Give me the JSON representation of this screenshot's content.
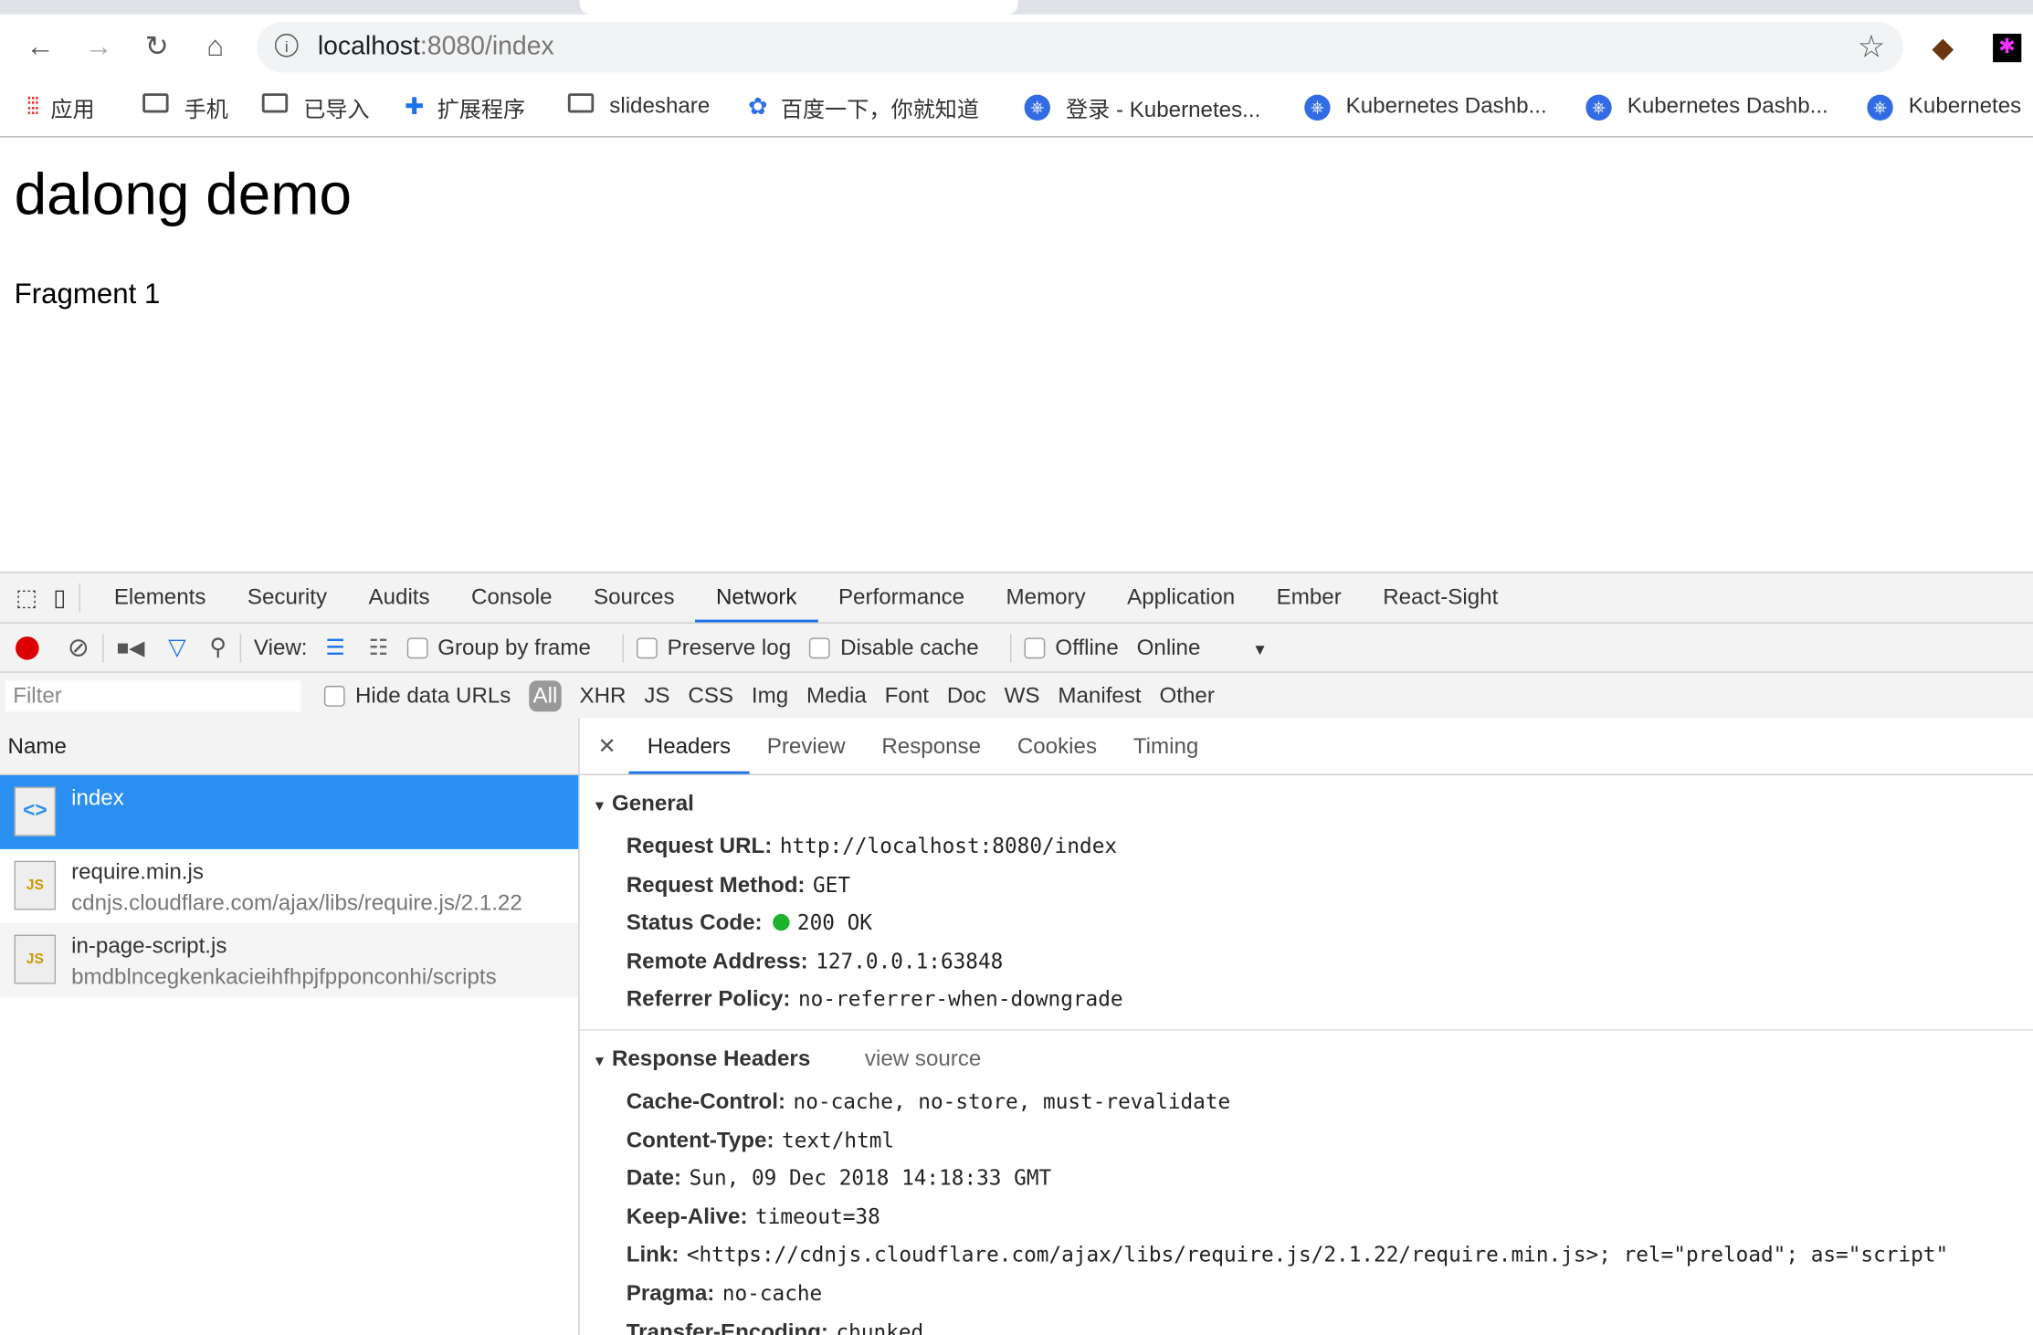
{
  "browser": {
    "url_host": "localhost",
    "url_rest": ":8080/index",
    "bookmarks": [
      {
        "label": "应用",
        "icon": "apps-grid-icon"
      },
      {
        "label": "手机",
        "icon": "folder-icon"
      },
      {
        "label": "已导入",
        "icon": "folder-icon"
      },
      {
        "label": "扩展程序",
        "icon": "puzzle-icon"
      },
      {
        "label": "slideshare",
        "icon": "folder-icon"
      },
      {
        "label": "百度一下，你就知道",
        "icon": "baidu-paw-icon"
      },
      {
        "label": "登录 - Kubernetes...",
        "icon": "kubernetes-icon"
      },
      {
        "label": "Kubernetes Dashb...",
        "icon": "kubernetes-icon"
      },
      {
        "label": "Kubernetes Dashb...",
        "icon": "kubernetes-icon"
      },
      {
        "label": "Kubernetes",
        "icon": "kubernetes-icon"
      }
    ]
  },
  "page": {
    "title": "dalong demo",
    "text": "Fragment 1"
  },
  "devtools": {
    "tabs": [
      "Elements",
      "Security",
      "Audits",
      "Console",
      "Sources",
      "Network",
      "Performance",
      "Memory",
      "Application",
      "Ember",
      "React-Sight"
    ],
    "active_tab": "Network",
    "toolbar": {
      "view": "View:",
      "group_by_frame": "Group by frame",
      "preserve_log": "Preserve log",
      "disable_cache": "Disable cache",
      "offline": "Offline",
      "throttle": "Online"
    },
    "filter": {
      "placeholder": "Filter",
      "hide_data_urls": "Hide data URLs",
      "types": [
        "All",
        "XHR",
        "JS",
        "CSS",
        "Img",
        "Media",
        "Font",
        "Doc",
        "WS",
        "Manifest",
        "Other"
      ]
    },
    "name_header": "Name",
    "requests": [
      {
        "name": "index",
        "path": ""
      },
      {
        "name": "require.min.js",
        "path": "cdnjs.cloudflare.com/ajax/libs/require.js/2.1.22"
      },
      {
        "name": "in-page-script.js",
        "path": "bmdblncegkenkacieihfhpjfpponconhi/scripts"
      }
    ],
    "detail_tabs": [
      "Headers",
      "Preview",
      "Response",
      "Cookies",
      "Timing"
    ],
    "general_title": "General",
    "general": [
      {
        "k": "Request URL:",
        "v": "http://localhost:8080/index"
      },
      {
        "k": "Request Method:",
        "v": "GET"
      },
      {
        "k": "Status Code:",
        "v": "200 OK"
      },
      {
        "k": "Remote Address:",
        "v": "127.0.0.1:63848"
      },
      {
        "k": "Referrer Policy:",
        "v": "no-referrer-when-downgrade"
      }
    ],
    "response_title": "Response Headers",
    "view_source": "view source",
    "response": [
      {
        "k": "Cache-Control:",
        "v": "no-cache, no-store, must-revalidate"
      },
      {
        "k": "Content-Type:",
        "v": "text/html"
      },
      {
        "k": "Date:",
        "v": "Sun, 09 Dec 2018 14:18:33 GMT"
      },
      {
        "k": "Keep-Alive:",
        "v": "timeout=38"
      },
      {
        "k": "Link:",
        "v": "<https://cdnjs.cloudflare.com/ajax/libs/require.js/2.1.22/require.min.js>; rel=\"preload\"; as=\"script\""
      },
      {
        "k": "Pragma:",
        "v": "no-cache"
      },
      {
        "k": "Transfer-Encoding:",
        "v": "chunked"
      }
    ]
  }
}
